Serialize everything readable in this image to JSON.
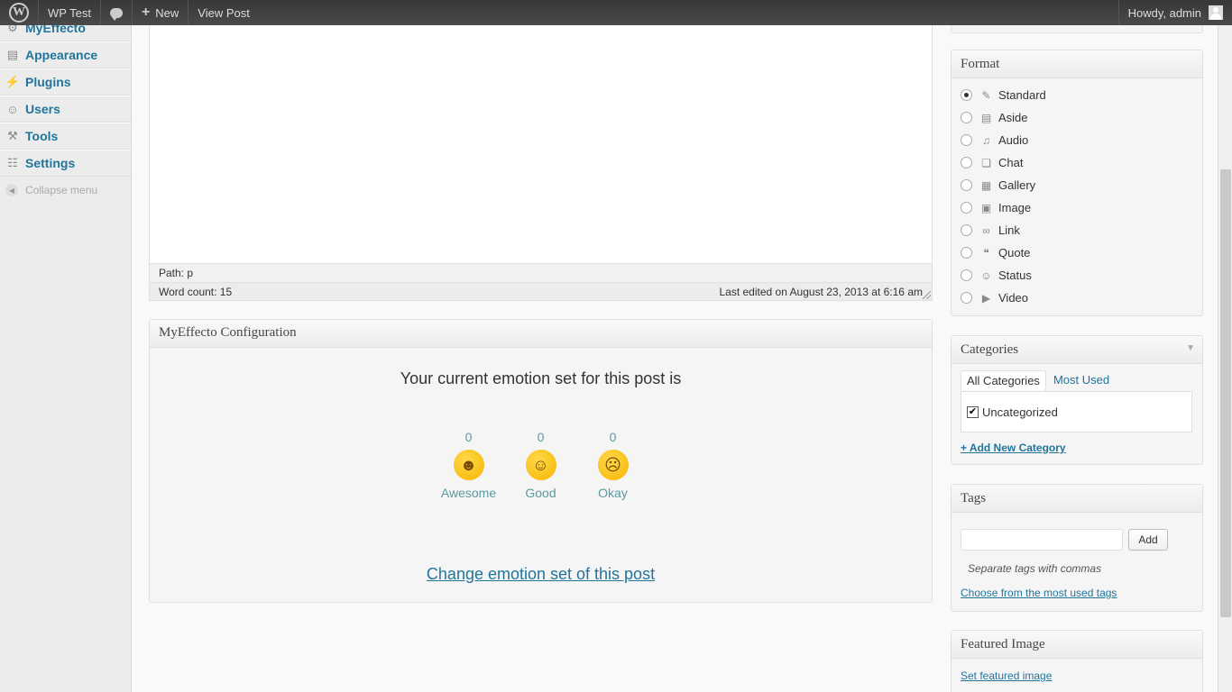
{
  "adminbar": {
    "site_name": "WP Test",
    "new_label": "New",
    "view_post_label": "View Post",
    "howdy": "Howdy, admin"
  },
  "sidebar": {
    "items": [
      {
        "label": "MyEffecto",
        "icon": "gear-icon"
      },
      {
        "label": "Appearance",
        "icon": "appearance-icon"
      },
      {
        "label": "Plugins",
        "icon": "plugin-icon"
      },
      {
        "label": "Users",
        "icon": "users-icon"
      },
      {
        "label": "Tools",
        "icon": "tools-icon"
      },
      {
        "label": "Settings",
        "icon": "settings-icon"
      }
    ],
    "collapse_label": "Collapse menu"
  },
  "editor": {
    "path": "Path: p",
    "word_count": "Word count: 15",
    "last_edited": "Last edited on August 23, 2013 at 6:16 am"
  },
  "myeffecto": {
    "title": "MyEffecto Configuration",
    "subtitle": "Your current emotion set for this post is",
    "emotions": [
      {
        "count": "0",
        "name": "Awesome"
      },
      {
        "count": "0",
        "name": "Good"
      },
      {
        "count": "0",
        "name": "Okay"
      }
    ],
    "change_link": "Change emotion set of this post"
  },
  "format": {
    "title": "Format",
    "options": [
      {
        "label": "Standard",
        "selected": true
      },
      {
        "label": "Aside",
        "selected": false
      },
      {
        "label": "Audio",
        "selected": false
      },
      {
        "label": "Chat",
        "selected": false
      },
      {
        "label": "Gallery",
        "selected": false
      },
      {
        "label": "Image",
        "selected": false
      },
      {
        "label": "Link",
        "selected": false
      },
      {
        "label": "Quote",
        "selected": false
      },
      {
        "label": "Status",
        "selected": false
      },
      {
        "label": "Video",
        "selected": false
      }
    ]
  },
  "categories": {
    "title": "Categories",
    "tab_all": "All Categories",
    "tab_most_used": "Most Used",
    "items": [
      {
        "label": "Uncategorized",
        "checked": true
      }
    ],
    "add_new": "+ Add New Category"
  },
  "tags": {
    "title": "Tags",
    "input_value": "",
    "add_button": "Add",
    "hint": "Separate tags with commas",
    "choose_link": "Choose from the most used tags"
  },
  "featured_image": {
    "title": "Featured Image",
    "set_link": "Set featured image"
  }
}
